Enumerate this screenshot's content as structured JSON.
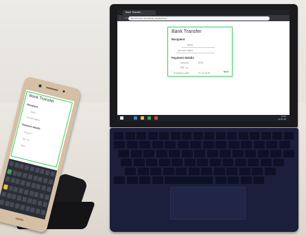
{
  "browser": {
    "tab_title": "Bank Transfer",
    "url": "file:///C:/web_demo/bank_transfer.html",
    "back": "←",
    "forward": "→",
    "reload": "⟳"
  },
  "laptop_form": {
    "title": "Bank Transfer",
    "recipient_heading": "Recipient",
    "recipient_fields": [
      "IBAN",
      "Account Name"
    ],
    "payment_heading": "Payment details",
    "payment_fields": [
      "Amount",
      "Ref. no.",
      "Execution date"
    ],
    "currency": "EUR",
    "date_value": "01.01.2018",
    "next_label": "Next"
  },
  "phone_form": {
    "title": "Bank Transfer",
    "recipient_heading": "Recipient",
    "recipient_fields": [
      "IBAN",
      "Account Name"
    ],
    "payment_heading": "Payment details",
    "payment_fields": [
      "Amount",
      "Ref. no.",
      "Date"
    ]
  },
  "taskbar": {
    "time": "13:45",
    "date": "12.04.18"
  },
  "colors": {
    "form_border": "#35d05a",
    "keyboard_cover": "#1b1f3b",
    "phone_gold": "#d5bfa5"
  }
}
